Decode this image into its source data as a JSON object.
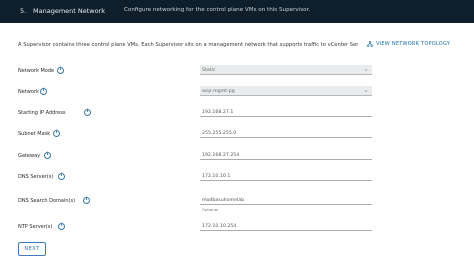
{
  "header": {
    "step": "5.",
    "title": "Management Network",
    "description": "Configure networking for the control plane VMs on this Supervisor."
  },
  "intro": "A Supervisor contains three control plane VMs. Each Supervisor sits on a management network that supports traffic to vCenter Server.",
  "topology_link": "VIEW NETWORK TOPOLOGY",
  "fields": {
    "network_mode": {
      "label": "Network Mode",
      "value": "Static"
    },
    "network": {
      "label": "Network",
      "value": "wcp-mgmt-pg"
    },
    "starting_ip": {
      "label": "Starting IP Address",
      "value": "192.168.27.1"
    },
    "subnet_mask": {
      "label": "Subnet Mask",
      "value": "255.255.255.0"
    },
    "gateway": {
      "label": "Gateway",
      "value": "192.168.27.254"
    },
    "dns_servers": {
      "label": "DNS Server(s)",
      "value": "172.10.10.1"
    },
    "dns_search": {
      "label": "DNS Search Domain(s)",
      "value": "modbasuhomelab",
      "hint": "Optional"
    },
    "ntp_servers": {
      "label": "NTP Server(s)",
      "value": "172.10.10.254"
    }
  },
  "buttons": {
    "next": "NEXT"
  }
}
